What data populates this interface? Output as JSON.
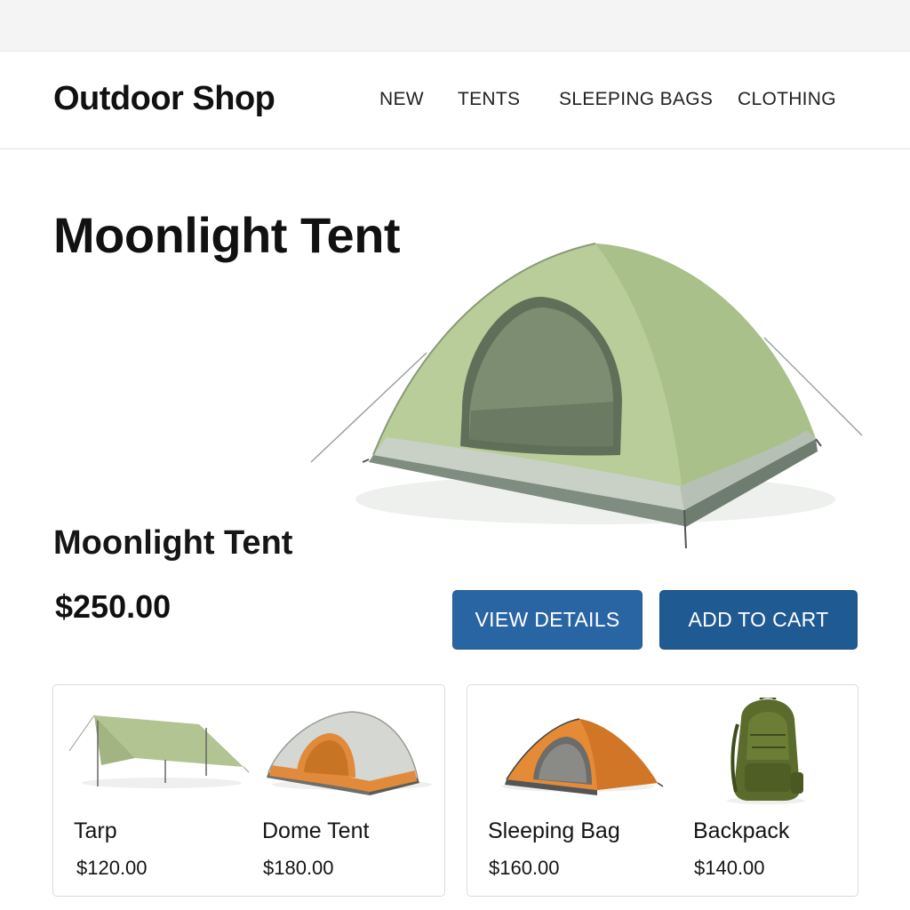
{
  "header": {
    "brand": "Outdoor Shop",
    "nav": [
      "NEW",
      "TENTS",
      "SLEEPING BAGS",
      "CLOTHING"
    ]
  },
  "hero": {
    "title": "Moonlight Tent",
    "product_name": "Moonlight Tent",
    "price": "$250.00",
    "image_icon": "dome-tent-image",
    "actions": {
      "view_details": "VIEW DETAILS",
      "add_to_cart": "ADD TO CART"
    }
  },
  "related": [
    {
      "name": "Tarp",
      "price": "$120.00",
      "icon": "tarp-image"
    },
    {
      "name": "Dome Tent",
      "price": "$180.00",
      "icon": "dome-tent-image"
    },
    {
      "name": "Sleeping Bag",
      "price": "$160.00",
      "icon": "orange-tent-image"
    },
    {
      "name": "Backpack",
      "price": "$140.00",
      "icon": "backpack-image"
    }
  ],
  "colors": {
    "button_primary": "#2a65a3",
    "button_cart": "#1f5a93",
    "tent_green": "#b7cc98",
    "tent_orange": "#e18a3c"
  }
}
